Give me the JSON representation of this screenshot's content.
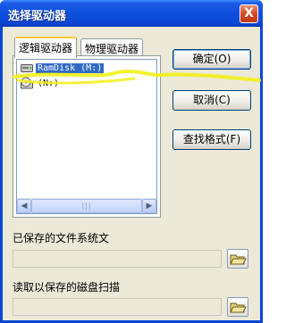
{
  "window": {
    "title": "选择驱动器",
    "close_glyph": "X"
  },
  "tabs": [
    {
      "label": "逻辑驱动器",
      "active": true
    },
    {
      "label": "物理驱动器",
      "active": false
    }
  ],
  "drives": [
    {
      "label": "RamDisk (M:)",
      "selected": true
    },
    {
      "label": "(N:)",
      "selected": false
    }
  ],
  "buttons": {
    "ok": "确定(O)",
    "cancel": "取消(C)",
    "find_format": "查找格式(F)"
  },
  "saved_fs": {
    "label": "已保存的文件系统文"
  },
  "saved_scan": {
    "label": "读取以保存的磁盘扫描"
  },
  "icons": {
    "drive": "drive-icon",
    "cd": "cd-icon",
    "folder": "open-folder-icon",
    "scroll_left": "◀",
    "scroll_right": "▶"
  },
  "colors": {
    "titlebar": "#0a45d3",
    "selection": "#316ac5",
    "highlight_marker": "#f2ef1a"
  }
}
